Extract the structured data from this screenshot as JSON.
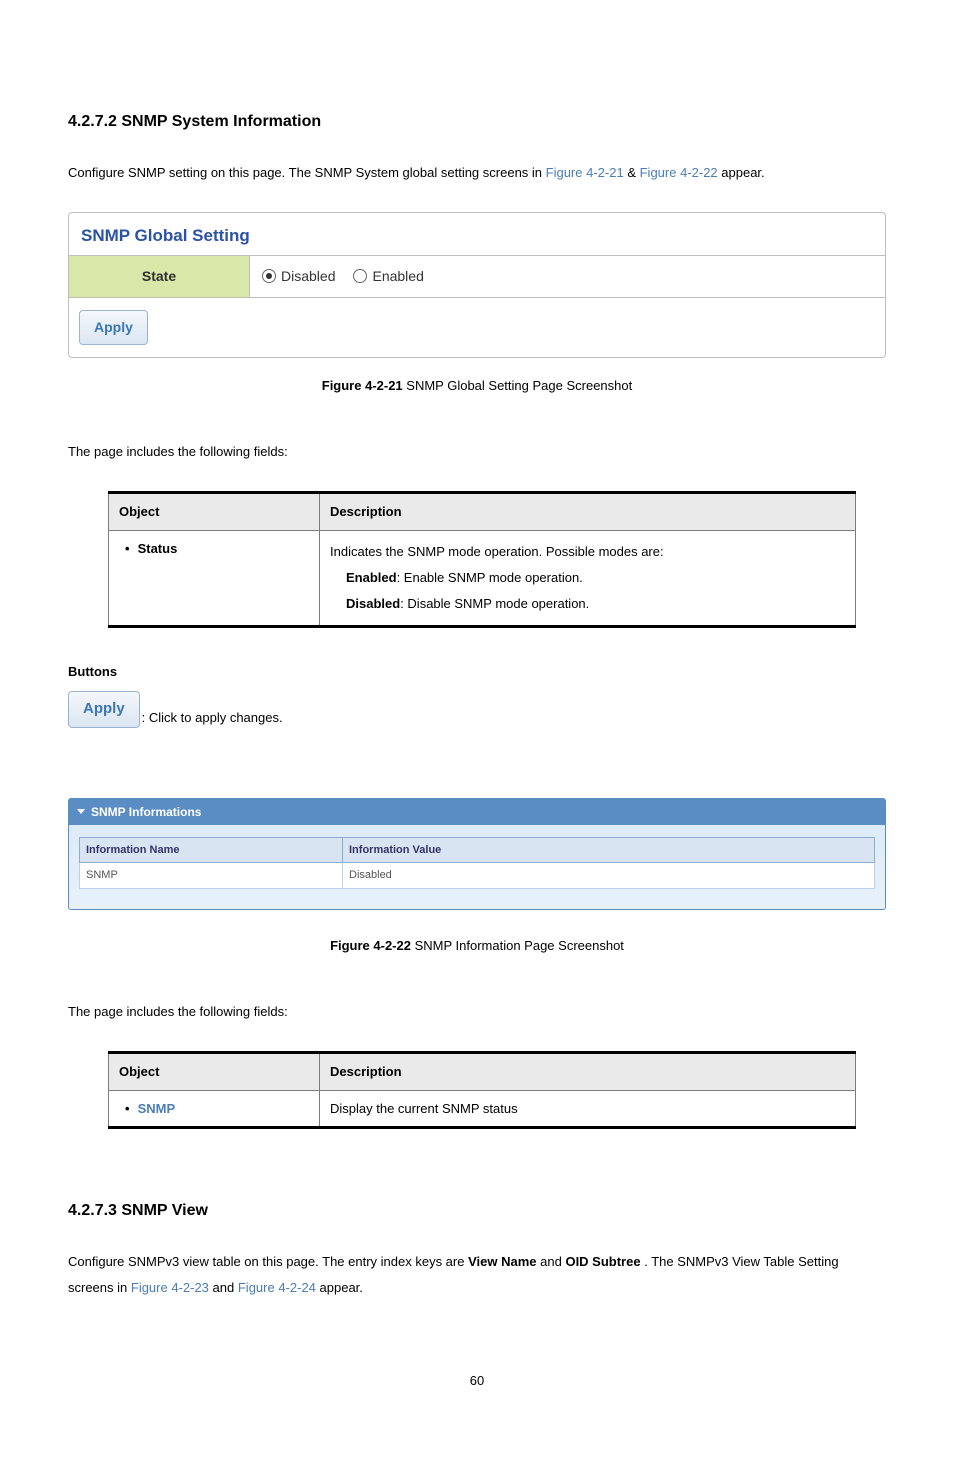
{
  "section1": {
    "heading": "4.2.7.2 SNMP System Information",
    "intro_prefix": "Configure SNMP setting on this page. The SNMP System global setting screens in ",
    "intro_link1": "Figure 4-2-21",
    "intro_amp": " & ",
    "intro_link2": "Figure 4-2-22",
    "intro_suffix": " appear."
  },
  "snmp_box": {
    "title": "SNMP Global Setting",
    "row_label": "State",
    "option_disabled": "Disabled",
    "option_enabled": "Enabled",
    "apply_label": "Apply"
  },
  "caption1": {
    "bold": "Figure 4-2-21",
    "rest": " SNMP Global Setting Page Screenshot"
  },
  "fields_intro": "The page includes the following fields:",
  "fields_table1": {
    "col_object": "Object",
    "col_desc": "Description",
    "row_obj": "Status",
    "row_desc_line1": "Indicates the SNMP mode operation. Possible modes are:",
    "row_desc_enabled_b": "Enabled",
    "row_desc_enabled_rest": ": Enable SNMP mode operation.",
    "row_desc_disabled_b": "Disabled",
    "row_desc_disabled_rest": ": Disable SNMP mode operation."
  },
  "buttons": {
    "heading": "Buttons",
    "apply_label": "Apply",
    "apply_desc": ": Click to apply changes."
  },
  "info_panel": {
    "header": "SNMP Informations",
    "col_name": "Information Name",
    "col_value": "Information Value",
    "row_name": "SNMP",
    "row_value": "Disabled"
  },
  "caption2": {
    "bold": "Figure 4-2-22",
    "rest": " SNMP Information Page Screenshot"
  },
  "fields_table2": {
    "col_object": "Object",
    "col_desc": "Description",
    "row_obj": "SNMP",
    "row_desc": "Display the current SNMP status"
  },
  "section2": {
    "heading": "4.2.7.3 SNMP View",
    "intro_prefix": "Configure SNMPv3 view table on this page. The entry index keys are ",
    "bold1": "View Name",
    "mid1": " and ",
    "bold2": "OID Subtree",
    "mid2": ". The SNMPv3 View Table Setting screens in ",
    "link1": "Figure 4-2-23",
    "mid3": " and ",
    "link2": "Figure 4-2-24",
    "suffix": " appear."
  },
  "page_number": "60"
}
